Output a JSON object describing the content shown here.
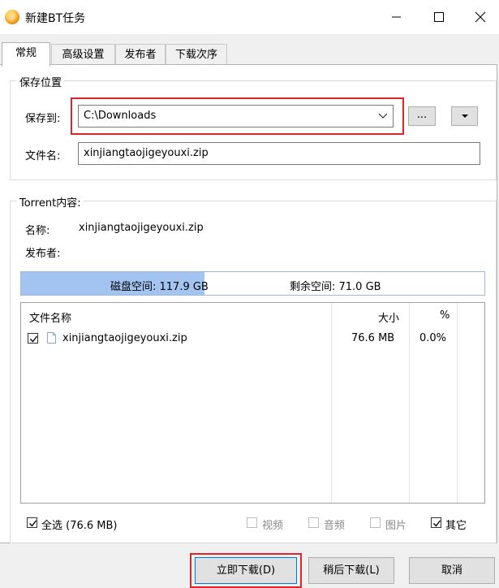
{
  "window": {
    "title": "新建BT任务"
  },
  "tabs": [
    "常规",
    "高级设置",
    "发布者",
    "下载次序"
  ],
  "save_group": {
    "title": "保存位置",
    "save_to_label": "保存到:",
    "save_to_value": "C:\\Downloads",
    "browse_label": "...",
    "filename_label": "文件名:",
    "filename_value": "xinjiangtaojigeyouxi.zip"
  },
  "torrent_group": {
    "title": "Torrent内容:",
    "name_label": "名称:",
    "name_value": "xinjiangtaojigeyouxi.zip",
    "publisher_label": "发布者:",
    "publisher_value": "",
    "disk_space_label": "磁盘空间: 117.9 GB",
    "free_space_label": "剩余空间: 71.0 GB",
    "disk_used_fraction": 0.395
  },
  "file_table": {
    "columns": [
      "文件名称",
      "大小",
      "%"
    ],
    "rows": [
      {
        "name": "xinjiangtaojigeyouxi.zip",
        "size": "76.6 MB",
        "percent": "0.0%",
        "checked": true
      }
    ]
  },
  "filters": {
    "select_all": "全选 (76.6 MB)",
    "video": "视频",
    "audio": "音频",
    "image": "图片",
    "other": "其它"
  },
  "buttons": {
    "download_now": "立即下载(D)",
    "download_later": "稍后下载(L)",
    "cancel": "取消"
  },
  "colors": {
    "highlight": "#e0242b",
    "disk_fill": "#a3c4f0"
  }
}
